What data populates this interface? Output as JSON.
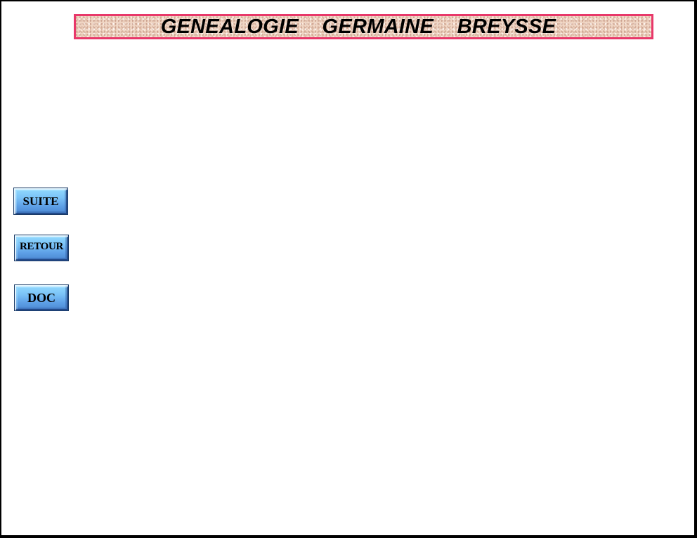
{
  "banner": {
    "title": "GENEALOGIE    GERMAINE    BREYSSE"
  },
  "nav": {
    "suite_label": "SUITE",
    "retour_label": "RETOUR",
    "doc_label": "DOC"
  },
  "colors": {
    "banner_border": "#e8386a",
    "banner_fill": "#f0d6c4",
    "button_top": "#93dbff",
    "button_bottom": "#4a86d0"
  }
}
